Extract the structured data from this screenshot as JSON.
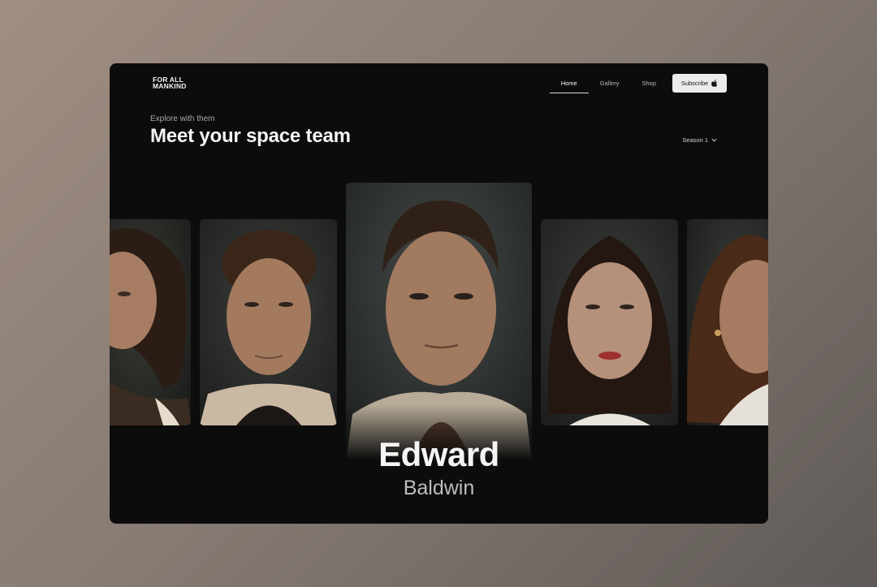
{
  "brand": {
    "logo_line1": "FOR ALL",
    "logo_line2": "MANKIND"
  },
  "nav": {
    "items": [
      {
        "label": "Home",
        "active": true
      },
      {
        "label": "Gallery",
        "active": false
      },
      {
        "label": "Shop",
        "active": false
      }
    ],
    "subscribe_label": "Subscribe",
    "subscribe_icon": "apple-icon"
  },
  "hero": {
    "eyebrow": "Explore with them",
    "title": "Meet your space team"
  },
  "season_select": {
    "selected": "Season 1",
    "icon": "chevron-down-icon"
  },
  "featured": {
    "first_name": "Edward",
    "last_name": "Baldwin"
  },
  "colors": {
    "background": "#0c0c0c",
    "accent": "#ececec",
    "text": "#f4f4f4"
  }
}
